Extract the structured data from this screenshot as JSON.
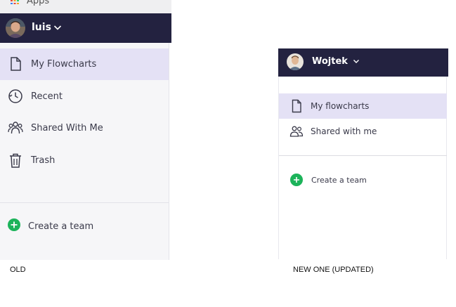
{
  "old": {
    "apps_label": "Apps",
    "user": {
      "name": "luis"
    },
    "nav": [
      {
        "label": "My Flowcharts",
        "icon": "document-icon",
        "active": true
      },
      {
        "label": "Recent",
        "icon": "clock-icon",
        "active": false
      },
      {
        "label": "Shared With Me",
        "icon": "people-icon",
        "active": false
      },
      {
        "label": "Trash",
        "icon": "trash-icon",
        "active": false
      }
    ],
    "create_team_label": "Create a team"
  },
  "new": {
    "user": {
      "name": "Wojtek"
    },
    "nav": [
      {
        "label": "My flowcharts",
        "icon": "document-icon",
        "active": true
      },
      {
        "label": "Shared with me",
        "icon": "people-icon",
        "active": false
      }
    ],
    "create_team_label": "Create a team"
  },
  "captions": {
    "old": "OLD",
    "new": "NEW ONE (UPDATED)"
  },
  "colors": {
    "header_bg": "#232240",
    "active_bg": "#e4e1f5",
    "plus_green": "#1cb35a",
    "apps_dots": [
      "#e84c3d",
      "#f5a623",
      "#2ecc71",
      "#3b82f6"
    ]
  }
}
